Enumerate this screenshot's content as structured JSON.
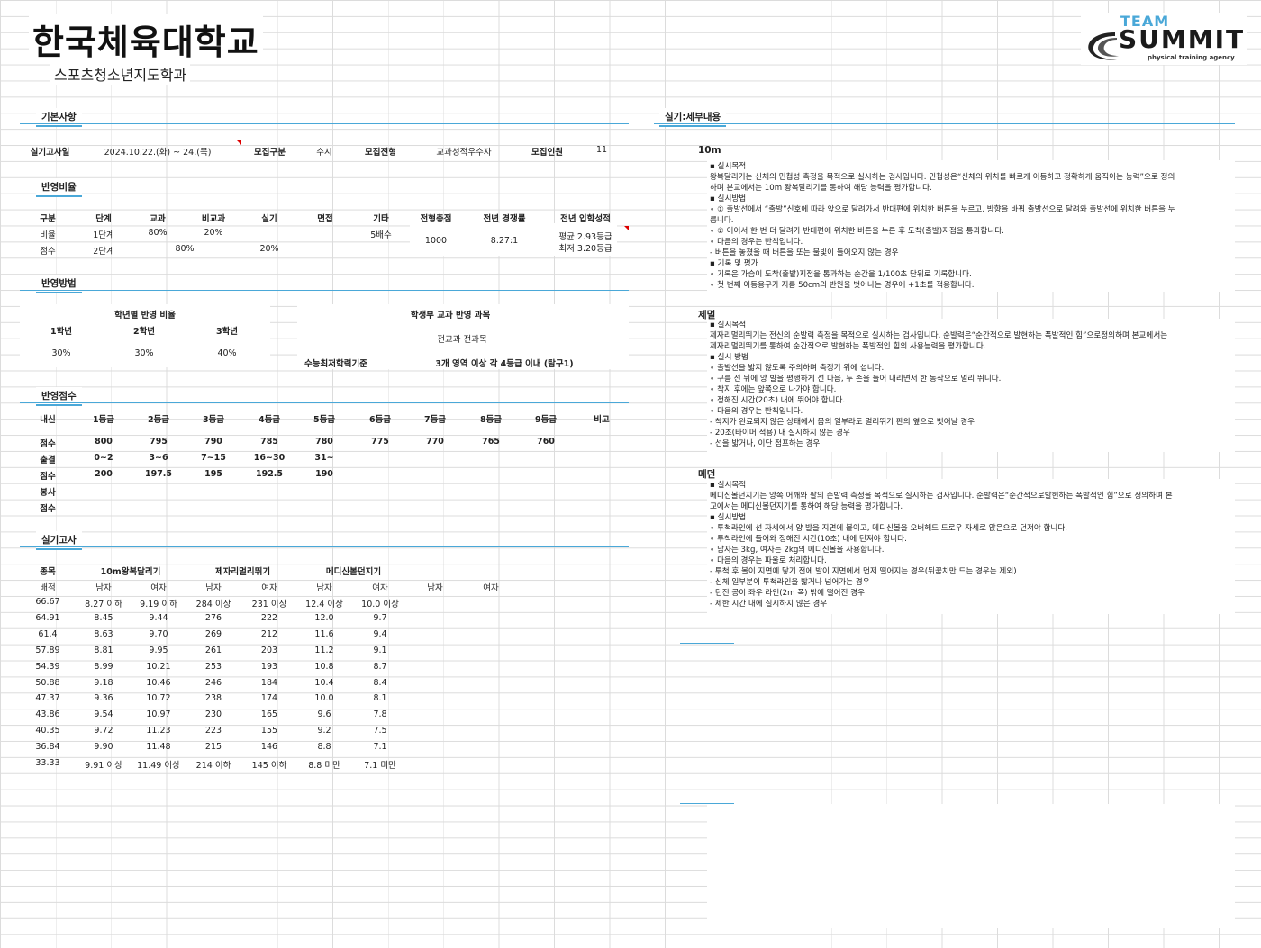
{
  "header": {
    "title": "한국체육대학교",
    "subtitle": "스포츠청소년지도학과",
    "logo_top": "TEAM",
    "logo_main": "SUMMIT",
    "logo_tag": "physical training agency"
  },
  "basic": {
    "section": "기본사항",
    "exam_date_label": "실기고사일",
    "exam_date": "2024.10.22.(화) ~ 24.(목)",
    "recruit_type_label": "모집구분",
    "recruit_type": "수시",
    "recruit_track_label": "모집전형",
    "recruit_track": "교과성적우수자",
    "recruit_count_label": "모집인원",
    "recruit_count": "11"
  },
  "ratio": {
    "section": "반영비율",
    "headers": [
      "구분",
      "단계",
      "교과",
      "비교과",
      "실기",
      "면접",
      "기타",
      "전형총점",
      "전년 경쟁률",
      "전년 입학성적"
    ],
    "row1": [
      "비율",
      "1단계",
      "80%",
      "20%",
      "",
      "",
      "5배수"
    ],
    "row2": [
      "점수",
      "2단계",
      "80%",
      "20%"
    ],
    "total": "1000",
    "competition": "8.27:1",
    "admission_avg": "평균 2.93등급",
    "admission_min": "최저 3.20등급"
  },
  "method": {
    "section": "반영방법",
    "grade_ratio_title": "학년별 반영 비율",
    "grades": [
      "1학년",
      "2학년",
      "3학년"
    ],
    "grade_values": [
      "30%",
      "30%",
      "40%"
    ],
    "subjects_title": "학생부 교과 반영 과목",
    "subjects": "전교과 전과목",
    "csat_label": "수능최저학력기준",
    "csat_value": "3개 영역 이상 각 4등급 이내 (탐구1)"
  },
  "score": {
    "section": "반영점수",
    "headers": [
      "내신",
      "1등급",
      "2등급",
      "3등급",
      "4등급",
      "5등급",
      "6등급",
      "7등급",
      "8등급",
      "9등급",
      "비고"
    ],
    "grade_scores": [
      "점수",
      "800",
      "795",
      "790",
      "785",
      "780",
      "775",
      "770",
      "765",
      "760"
    ],
    "attendance": [
      "출결",
      "0~2",
      "3~6",
      "7~15",
      "16~30",
      "31~"
    ],
    "attendance_scores": [
      "점수",
      "200",
      "197.5",
      "195",
      "192.5",
      "190"
    ],
    "volunteer": [
      "봉사"
    ],
    "volunteer_scores": [
      "점수"
    ]
  },
  "practical": {
    "section": "실기고사",
    "headers": [
      "종목",
      "10m왕복달리기",
      "제자리멀리뛰기",
      "메디신볼던지기"
    ],
    "subheaders": [
      "배점",
      "남자",
      "여자",
      "남자",
      "여자",
      "남자",
      "여자",
      "남자",
      "여자"
    ],
    "rows": [
      [
        "66.67",
        "8.27 이하",
        "9.19 이하",
        "284 이상",
        "231 이상",
        "12.4 이상",
        "10.0 이상"
      ],
      [
        "64.91",
        "8.45",
        "9.44",
        "276",
        "222",
        "12.0",
        "9.7"
      ],
      [
        "61.4",
        "8.63",
        "9.70",
        "269",
        "212",
        "11.6",
        "9.4"
      ],
      [
        "57.89",
        "8.81",
        "9.95",
        "261",
        "203",
        "11.2",
        "9.1"
      ],
      [
        "54.39",
        "8.99",
        "10.21",
        "253",
        "193",
        "10.8",
        "8.7"
      ],
      [
        "50.88",
        "9.18",
        "10.46",
        "246",
        "184",
        "10.4",
        "8.4"
      ],
      [
        "47.37",
        "9.36",
        "10.72",
        "238",
        "174",
        "10.0",
        "8.1"
      ],
      [
        "43.86",
        "9.54",
        "10.97",
        "230",
        "165",
        "9.6",
        "7.8"
      ],
      [
        "40.35",
        "9.72",
        "11.23",
        "223",
        "155",
        "9.2",
        "7.5"
      ],
      [
        "36.84",
        "9.90",
        "11.48",
        "215",
        "146",
        "8.8",
        "7.1"
      ],
      [
        "33.33",
        "9.91 이상",
        "11.49 이상",
        "214 이하",
        "145 이하",
        "8.8 미만",
        "7.1 미만"
      ]
    ]
  },
  "detail": {
    "section": "실기:세부내용",
    "events": [
      {
        "name": "10m",
        "lines": [
          "▪ 실시목적",
          "  왕복달리기는 신체의 민첩성 측정을 목적으로 실시하는 검사입니다. 민첩성은“신체의 위치를 빠르게 이동하고 정확하게 움직이는 능력”으로 정의",
          "하며 본교에서는 10m 왕복달리기를 통하여 해당 능력을 평가합니다.",
          "▪ 실시방법",
          "∘ ① 출발선에서 “출발”신호에 따라 앞으로 달려가서 반대편에 위치한 버튼을 누르고, 방향을 바꿔 출발선으로 달려와 출발선에 위치한 버튼을 누",
          "릅니다.",
          "∘ ② 이어서 한 번 더 달려가 반대편에 위치한 버튼을 누른 후 도착(출발)지점을 통과합니다.",
          "∘ 다음의 경우는 반칙입니다.",
          "- 버튼을 놓쳤을 때 버튼을 또는 불빛이 들어오지 않는 경우",
          "▪ 기록 및 평가",
          "∘ 기록은 가슴이 도착(출발)지점을 통과하는 순간을 1/100초 단위로 기록합니다.",
          "∘ 첫 번째 이동용구가 지름 50cm의 반원을 벗어나는 경우에 +1초를 적용합니다."
        ]
      },
      {
        "name": "제멀",
        "lines": [
          "▪ 실시목적",
          "  제자리멀리뛰기는 전신의 순발력 측정을 목적으로 실시하는 검사입니다. 순발력은“순간적으로 발현하는 폭발적인 힘”으로정의하며 본교에서는",
          "제자리멀리뛰기를 통하여 순간적으로 발현하는 폭발적인 힘의 사용능력을 평가합니다.",
          "▪ 실시 방법",
          "∘ 출발선을 밟지 않도록 주의하며 측정기 위에 섭니다.",
          "∘ 구름 선 뒤에 양 발을 평행하게 선 다음, 두 손을 들어 내리면서 한 동작으로 멀리 뛰니다.",
          "∘ 착지 후에는 앞쪽으로 나가야 합니다.",
          "∘ 정해진 시간(20초) 내에 뛰어야 합니다.",
          "∘ 다음의 경우는 반칙입니다.",
          "- 착지가 완료되지 않은 상태에서 몸의 일부라도 멀리뛰기 판의 옆으로 벗어날 경우",
          "- 20초(타이머 적용) 내 실시하지 않는 경우",
          "- 선을 밟거나, 이단 점프하는 경우"
        ]
      },
      {
        "name": "메던",
        "lines": [
          "▪ 실시목적",
          "  메디신볼던지기는 양쪽 어깨와 팔의 순발력 측정을 목적으로 실시하는 검사입니다. 순발력은“순간적으로발현하는 폭발적인 힘”으로 정의하며 본",
          "교에서는 메디신볼던지기를 통하여 해당 능력을 평가합니다.",
          "▪ 실시방법",
          "∘ 투척라인에 선 자세에서 양 발을 지면에 붙이고, 메디신볼을 오버헤드 드로우 자세로 앉은으로 던져야 합니다.",
          "∘ 투척라인에 들어와 정해진 시간(10초) 내에 던져야 합니다.",
          "∘ 남자는 3kg, 여자는 2kg의 메디신볼을 사용합니다.",
          "∘ 다음의 경우는 파울로 처리합니다.",
          "- 투척 후 볼이 지면에 닿기 전에 발이 지면에서 먼저 떨어지는 경우(뒤꿈치만 드는 경우는 제외)",
          "- 신체 일부분이 투척라인을 밟거나 넘어가는 경우",
          "- 던진 공이 좌우 라인(2m 폭) 밖에 떨어진 경우",
          "- 제한 시간 내에 실시하지 않은 경우"
        ]
      }
    ]
  },
  "colors": {
    "accent": "#4aa8d8",
    "note": "#dd0000"
  }
}
